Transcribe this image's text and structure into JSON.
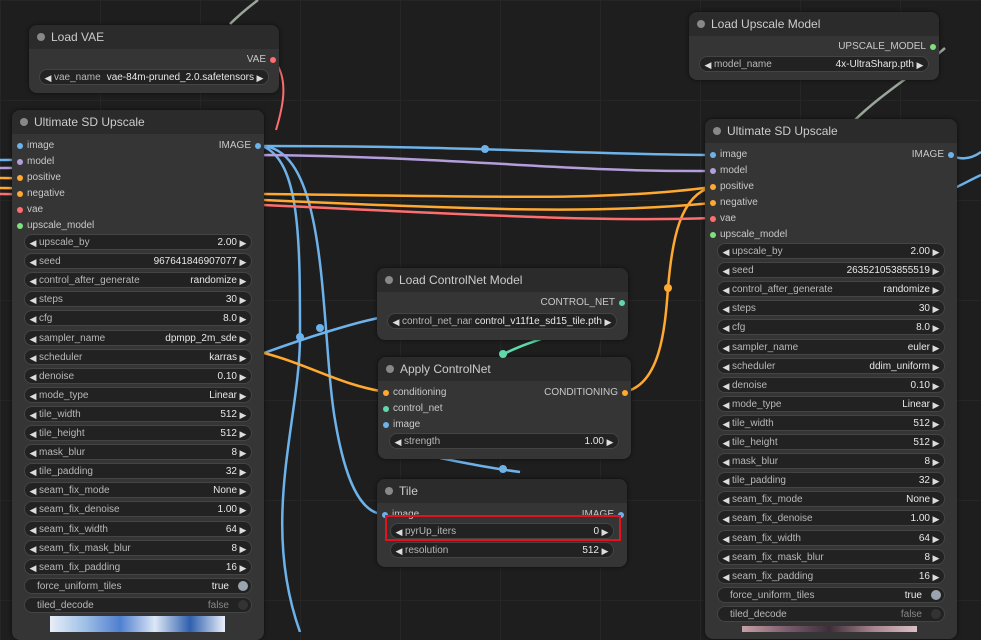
{
  "colors": {
    "image": "#6eb2ea",
    "model": "#b39ddb",
    "conditioning": "#ffa931",
    "vae": "#ff6e6e",
    "upscale_model": "#7fe07f",
    "control_net": "#5fd9a9",
    "wire_gray": "#9aa69a"
  },
  "load_vae": {
    "title": "Load VAE",
    "output": "VAE",
    "widgets": [
      {
        "label": "vae_name",
        "value": "vae-84m-pruned_2.0.safetensors"
      }
    ]
  },
  "load_upscale_model": {
    "title": "Load Upscale Model",
    "output": "UPSCALE_MODEL",
    "widgets": [
      {
        "label": "model_name",
        "value": "4x-UltraSharp.pth"
      }
    ]
  },
  "usd_left": {
    "title": "Ultimate SD Upscale",
    "output": "IMAGE",
    "inputs": [
      "image",
      "model",
      "positive",
      "negative",
      "vae",
      "upscale_model"
    ],
    "widgets": [
      {
        "label": "upscale_by",
        "value": "2.00"
      },
      {
        "label": "seed",
        "value": "967641846907077"
      },
      {
        "label": "control_after_generate",
        "value": "randomize"
      },
      {
        "label": "steps",
        "value": "30"
      },
      {
        "label": "cfg",
        "value": "8.0"
      },
      {
        "label": "sampler_name",
        "value": "dpmpp_2m_sde"
      },
      {
        "label": "scheduler",
        "value": "karras"
      },
      {
        "label": "denoise",
        "value": "0.10"
      },
      {
        "label": "mode_type",
        "value": "Linear"
      },
      {
        "label": "tile_width",
        "value": "512"
      },
      {
        "label": "tile_height",
        "value": "512"
      },
      {
        "label": "mask_blur",
        "value": "8"
      },
      {
        "label": "tile_padding",
        "value": "32"
      },
      {
        "label": "seam_fix_mode",
        "value": "None"
      },
      {
        "label": "seam_fix_denoise",
        "value": "1.00"
      },
      {
        "label": "seam_fix_width",
        "value": "64"
      },
      {
        "label": "seam_fix_mask_blur",
        "value": "8"
      },
      {
        "label": "seam_fix_padding",
        "value": "16"
      }
    ],
    "toggles": [
      {
        "label": "force_uniform_tiles",
        "value": "true"
      },
      {
        "label": "tiled_decode",
        "value": "false"
      }
    ]
  },
  "usd_right": {
    "title": "Ultimate SD Upscale",
    "output": "IMAGE",
    "inputs": [
      "image",
      "model",
      "positive",
      "negative",
      "vae",
      "upscale_model"
    ],
    "widgets": [
      {
        "label": "upscale_by",
        "value": "2.00"
      },
      {
        "label": "seed",
        "value": "263521053855519"
      },
      {
        "label": "control_after_generate",
        "value": "randomize"
      },
      {
        "label": "steps",
        "value": "30"
      },
      {
        "label": "cfg",
        "value": "8.0"
      },
      {
        "label": "sampler_name",
        "value": "euler"
      },
      {
        "label": "scheduler",
        "value": "ddim_uniform"
      },
      {
        "label": "denoise",
        "value": "0.10"
      },
      {
        "label": "mode_type",
        "value": "Linear"
      },
      {
        "label": "tile_width",
        "value": "512"
      },
      {
        "label": "tile_height",
        "value": "512"
      },
      {
        "label": "mask_blur",
        "value": "8"
      },
      {
        "label": "tile_padding",
        "value": "32"
      },
      {
        "label": "seam_fix_mode",
        "value": "None"
      },
      {
        "label": "seam_fix_denoise",
        "value": "1.00"
      },
      {
        "label": "seam_fix_width",
        "value": "64"
      },
      {
        "label": "seam_fix_mask_blur",
        "value": "8"
      },
      {
        "label": "seam_fix_padding",
        "value": "16"
      }
    ],
    "toggles": [
      {
        "label": "force_uniform_tiles",
        "value": "true"
      },
      {
        "label": "tiled_decode",
        "value": "false"
      }
    ]
  },
  "load_controlnet": {
    "title": "Load ControlNet Model",
    "output": "CONTROL_NET",
    "widgets": [
      {
        "label": "control_net_name",
        "value": "control_v11f1e_sd15_tile.pth"
      }
    ]
  },
  "apply_controlnet": {
    "title": "Apply ControlNet",
    "output": "CONDITIONING",
    "inputs": [
      "conditioning",
      "control_net",
      "image"
    ],
    "widgets": [
      {
        "label": "strength",
        "value": "1.00"
      }
    ]
  },
  "tile": {
    "title": "Tile",
    "output": "IMAGE",
    "inputs": [
      "image"
    ],
    "widgets": [
      {
        "label": "pyrUp_iters",
        "value": "0"
      },
      {
        "label": "resolution",
        "value": "512"
      }
    ]
  }
}
